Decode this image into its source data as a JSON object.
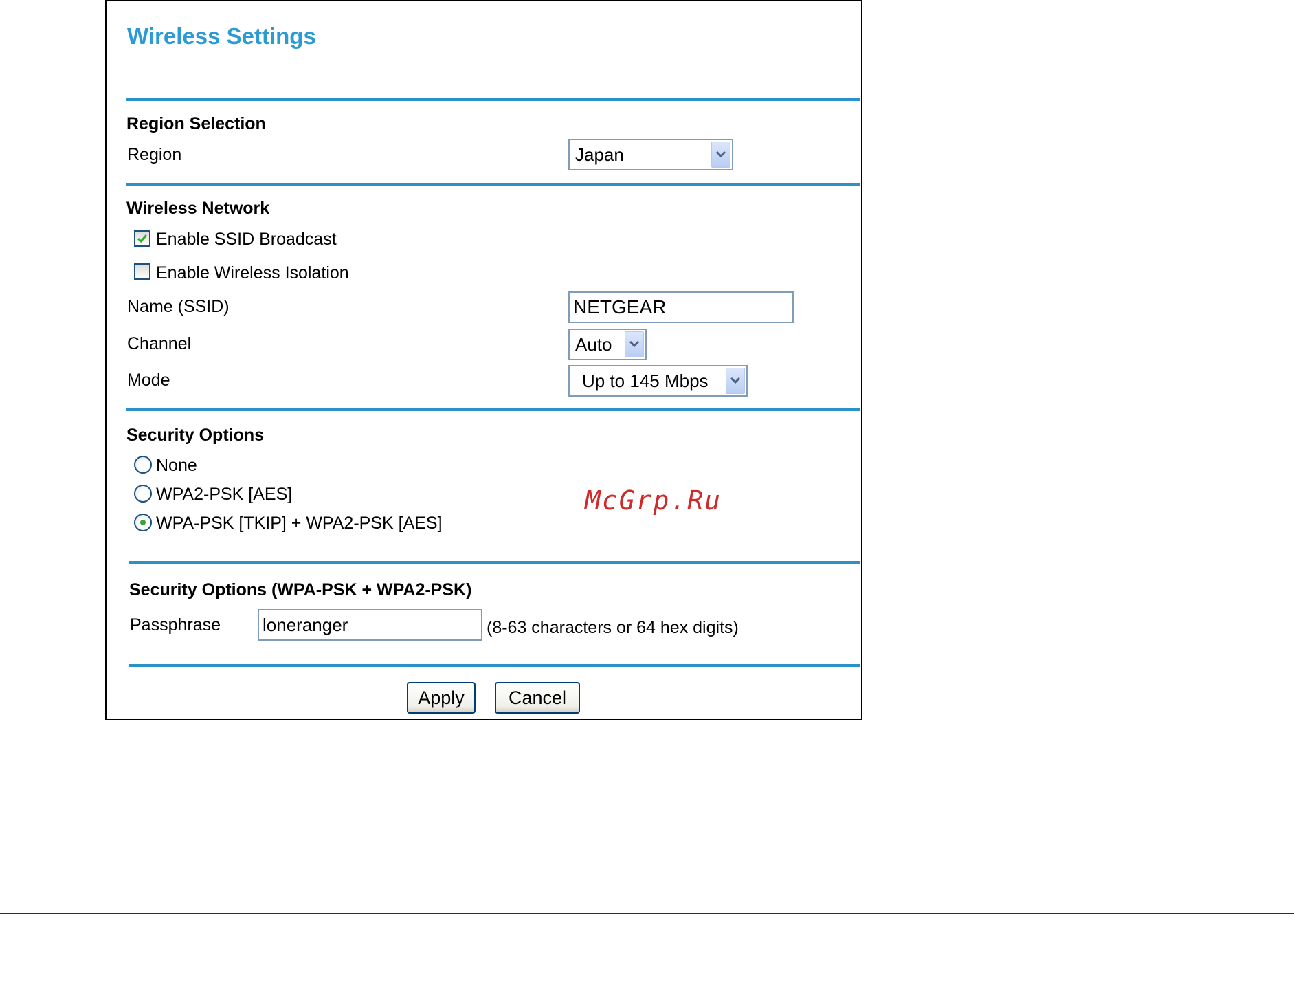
{
  "page": {
    "title": "Wireless Settings"
  },
  "region_section": {
    "heading": "Region Selection",
    "region_label": "Region",
    "region_value": "Japan"
  },
  "wireless_network": {
    "heading": "Wireless Network",
    "enable_ssid_broadcast": {
      "label": "Enable SSID Broadcast",
      "checked": true
    },
    "enable_wireless_isolation": {
      "label": "Enable Wireless Isolation",
      "checked": false
    },
    "ssid_label": "Name (SSID)",
    "ssid_value": "NETGEAR",
    "channel_label": "Channel",
    "channel_value": "Auto",
    "mode_label": "Mode",
    "mode_value": "Up to 145 Mbps"
  },
  "security_options": {
    "heading": "Security Options",
    "options": [
      {
        "label": "None",
        "selected": false
      },
      {
        "label": "WPA2-PSK [AES]",
        "selected": false
      },
      {
        "label": "WPA-PSK [TKIP] + WPA2-PSK [AES]",
        "selected": true
      }
    ]
  },
  "passphrase_section": {
    "heading": "Security Options (WPA-PSK + WPA2-PSK)",
    "passphrase_label": "Passphrase",
    "passphrase_value": "loneranger",
    "hint": "(8-63 characters or 64 hex digits)"
  },
  "buttons": {
    "apply_label": "Apply",
    "cancel_label": "Cancel"
  },
  "watermark": "McGrp.Ru",
  "colors": {
    "title": "#2b9bd1",
    "divider": "#2a92c8",
    "watermark": "#cf2b2b",
    "checkmark": "#3aa43a"
  }
}
